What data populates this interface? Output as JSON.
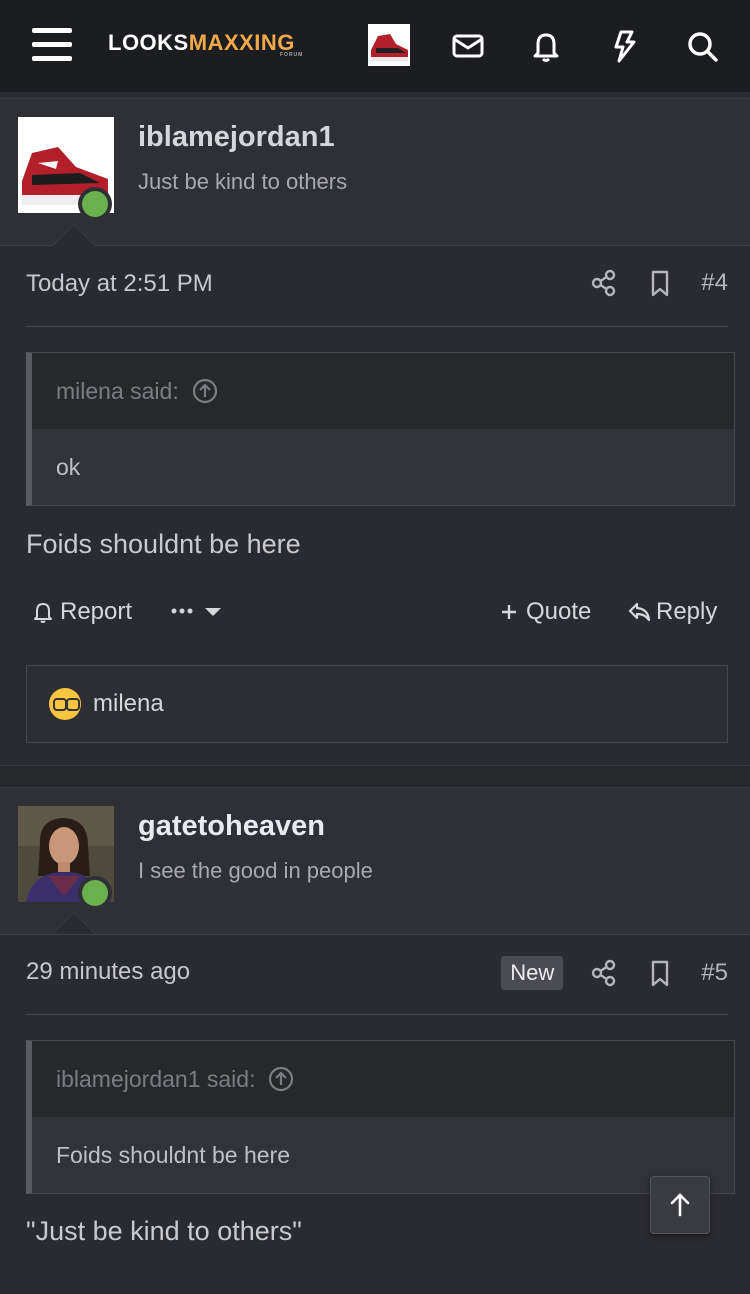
{
  "nav": {
    "logo_part1": "LOOKS",
    "logo_part2": "MAXXING",
    "logo_sub": "FORUM",
    "icons": [
      "menu-icon",
      "envelope-icon",
      "bell-icon",
      "bolt-icon",
      "search-icon"
    ]
  },
  "posts": [
    {
      "username": "iblamejordan1",
      "user_title": "Just be kind to others",
      "time": "Today at 2:51 PM",
      "post_number": "#4",
      "quote_author": "milena said:",
      "quote_text": "ok",
      "message": "Foids shouldnt be here",
      "report_label": "Report",
      "quote_label": "Quote",
      "reply_label": "Reply",
      "reaction_user": "milena"
    },
    {
      "username": "gatetoheaven",
      "user_title": "I see the good in people",
      "time": "29 minutes ago",
      "badge": "New",
      "post_number": "#5",
      "quote_author": "iblamejordan1 said:",
      "quote_text": "Foids shouldnt be here",
      "message": "\"Just be kind to others\""
    }
  ],
  "colors": {
    "accent": "#f0a94a",
    "online": "#6ab04c",
    "background": "#2a2b30"
  }
}
